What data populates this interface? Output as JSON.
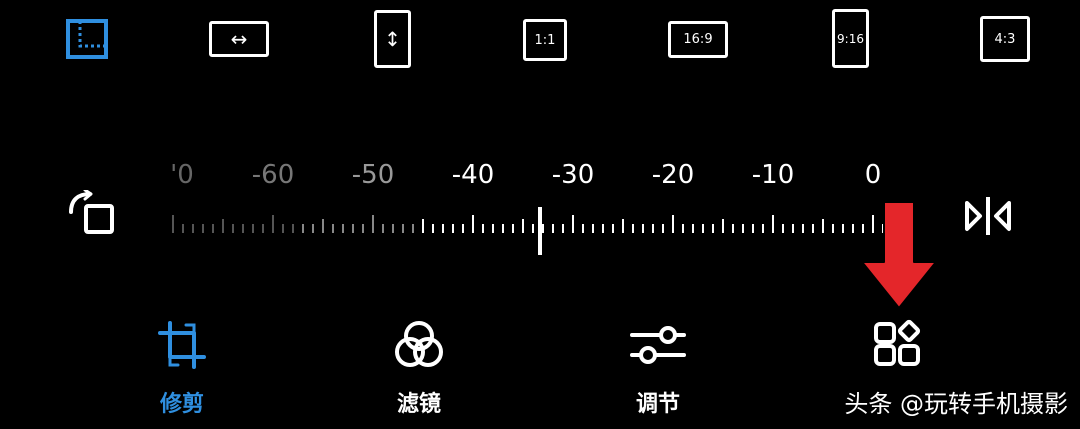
{
  "aspect_ratios": {
    "free_label": "",
    "horizontal_label": "↔",
    "vertical_label": "↕",
    "r1_1": "1:1",
    "r16_9": "16:9",
    "r9_16": "9:16",
    "r4_3": "4:3"
  },
  "rotation_ruler": {
    "labels": [
      "'0",
      "-60",
      "-50",
      "-40",
      "-30",
      "-20",
      "-10",
      "0"
    ],
    "current_value": -34
  },
  "tabs": [
    {
      "label": "修剪",
      "icon": "crop-icon",
      "active": true
    },
    {
      "label": "滤镜",
      "icon": "filter-icon",
      "active": false
    },
    {
      "label": "调节",
      "icon": "adjust-sliders-icon",
      "active": false
    },
    {
      "label": "",
      "icon": "more-apps-icon",
      "active": false
    }
  ],
  "watermark": "头条 @玩转手机摄影",
  "colors": {
    "accent": "#2f8fe0",
    "arrow": "#e4262a",
    "background": "#000000"
  }
}
